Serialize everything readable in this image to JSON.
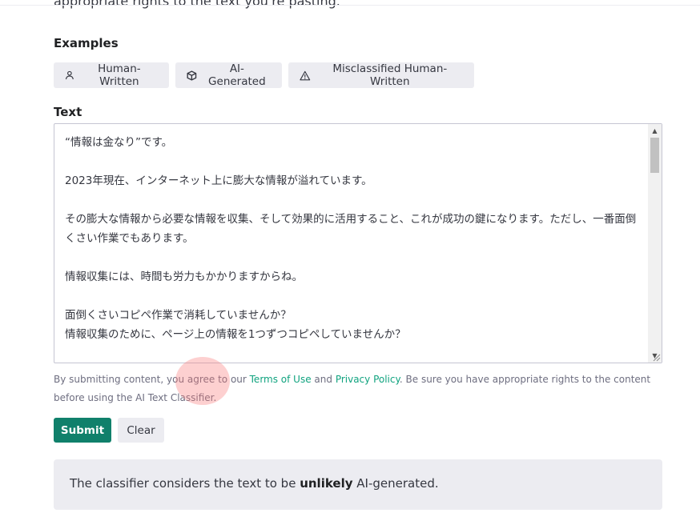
{
  "intro": {
    "text": "appropriate rights to the text you're pasting."
  },
  "examples": {
    "label": "Examples",
    "buttons": [
      {
        "label": "Human-Written",
        "icon": "person-icon"
      },
      {
        "label": "AI-Generated",
        "icon": "cube-icon"
      },
      {
        "label": "Misclassified Human-Written",
        "icon": "warning-icon"
      }
    ]
  },
  "text_section": {
    "label": "Text",
    "lines": [
      "“情報は金なり”です。",
      "",
      "2023年現在、インターネット上に膨大な情報が溢れています。",
      "",
      "その膨大な情報から必要な情報を収集、そして効果的に活用すること、これが成功の鍵になります。ただし、一番面倒くさい作業でもあります。",
      "",
      "情報収集には、時間も労力もかかりますからね。",
      "",
      "面倒くさいコピペ作業で消耗していませんか？",
      "情報収集のために、ページ上の情報を1つずつコピペしていませんか？"
    ]
  },
  "terms": {
    "prefix": "By submitting content, you agree to our ",
    "terms_link": "Terms of Use",
    "middle": " and ",
    "privacy_link": "Privacy Policy",
    "suffix": ". Be sure you have appropriate rights to the content before using the AI Text Classifier."
  },
  "actions": {
    "submit_label": "Submit",
    "clear_label": "Clear"
  },
  "result": {
    "prefix": "The classifier considers the text to be ",
    "verdict": "unlikely",
    "suffix": " AI-generated."
  },
  "colors": {
    "accent": "#10806b",
    "link": "#10a37f",
    "button_bg": "#ececf1"
  }
}
